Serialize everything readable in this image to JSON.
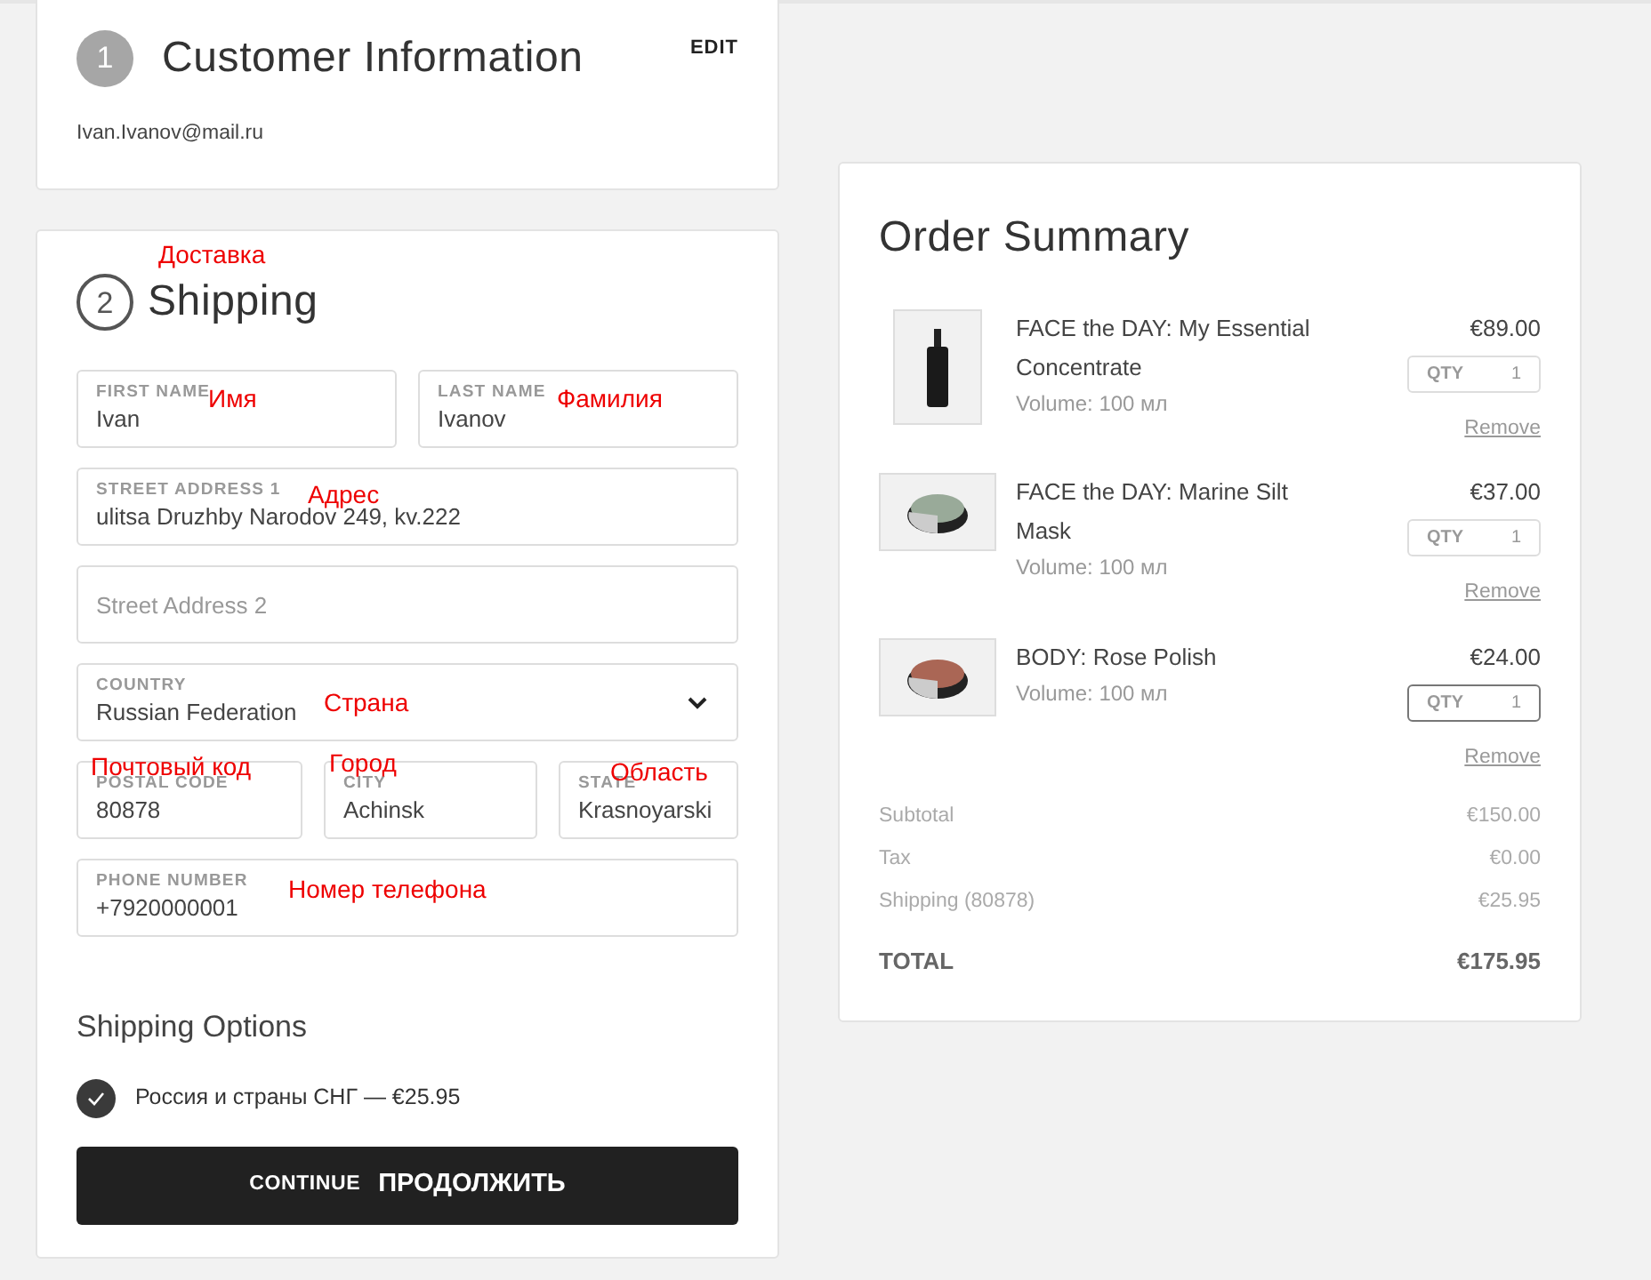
{
  "customer": {
    "step": "1",
    "title": "Customer Information",
    "edit": "EDIT",
    "email": "Ivan.Ivanov@mail.ru"
  },
  "shipping": {
    "step": "2",
    "title": "Shipping",
    "note": "Доставка",
    "fields": [
      {
        "label": "FIRST NAME",
        "value": "Ivan",
        "note": "Имя"
      },
      {
        "label": "LAST NAME",
        "value": "Ivanov",
        "note": "Фамилия"
      },
      {
        "label": "STREET ADDRESS 1",
        "value": "ulitsa Druzhby Narodov 249, kv.222",
        "note": "Адрес"
      },
      {
        "placeholder": "Street Address 2"
      },
      {
        "kind": "select",
        "label": "COUNTRY",
        "value": "Russian Federation",
        "note": "Страна"
      },
      {
        "label": "POSTAL CODE",
        "value": "80878",
        "note": "Почтовый код"
      },
      {
        "label": "CITY",
        "value": "Achinsk",
        "note": "Город"
      },
      {
        "label": "STATE",
        "value": "Krasnoyarski",
        "note": "Область"
      },
      {
        "label": "PHONE NUMBER",
        "value": "+7920000001",
        "note": "Номер телефона"
      }
    ],
    "options_title": "Shipping Options",
    "options": [
      {
        "label": "Россия и страны СНГ — €25.95",
        "checked": true
      }
    ],
    "continue": {
      "label": "CONTINUE",
      "note": "ПРОДОЛЖИТЬ"
    }
  },
  "summary": {
    "title": "Order Summary",
    "items": [
      {
        "name": "FACE the DAY: My Essential Concentrate",
        "volume": "Volume: 100 мл",
        "price": "€89.00",
        "qty_label": "QTY",
        "qty": "1",
        "focused": false,
        "remove": "Remove",
        "kind": "bottle"
      },
      {
        "name": "FACE the DAY: Marine Silt Mask",
        "volume": "Volume: 100 мл",
        "price": "€37.00",
        "qty_label": "QTY",
        "qty": "1",
        "focused": false,
        "remove": "Remove",
        "kind": "jar"
      },
      {
        "name": "BODY: Rose Polish",
        "volume": "Volume: 100 мл",
        "price": "€24.00",
        "qty_label": "QTY",
        "qty": "1",
        "focused": true,
        "remove": "Remove",
        "kind": "jar"
      }
    ],
    "totals": [
      {
        "label": "Subtotal",
        "value": "€150.00"
      },
      {
        "label": "Tax",
        "value": "€0.00"
      },
      {
        "label": "Shipping (80878)",
        "value": "€25.95"
      }
    ],
    "total": {
      "label": "TOTAL",
      "value": "€175.95"
    }
  }
}
